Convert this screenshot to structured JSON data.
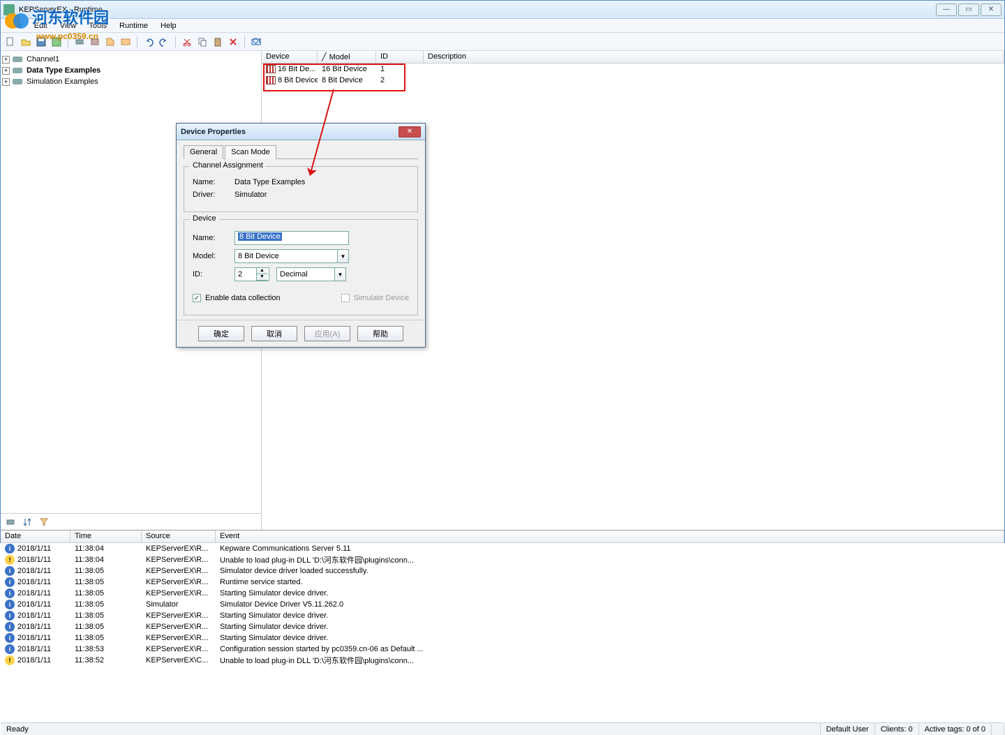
{
  "window": {
    "title": "KEPServerEX - Runtime"
  },
  "watermark": {
    "text": "河东软件园",
    "url": "www.pc0359.cn"
  },
  "menu": {
    "file": "File",
    "edit": "Edit",
    "view": "View",
    "tools": "Tools",
    "runtime": "Runtime",
    "help": "Help"
  },
  "tree": {
    "items": [
      {
        "label": "Channel1",
        "bold": false
      },
      {
        "label": "Data Type Examples",
        "bold": true
      },
      {
        "label": "Simulation Examples",
        "bold": false
      }
    ]
  },
  "grid": {
    "cols": {
      "device": "Device",
      "model": "Model",
      "id": "ID",
      "desc": "Description"
    },
    "rows": [
      {
        "device": "16 Bit De...",
        "model": "16 Bit Device",
        "id": "1"
      },
      {
        "device": "8 Bit Device",
        "model": "8 Bit Device",
        "id": "2"
      }
    ]
  },
  "dialog": {
    "title": "Device Properties",
    "tabs": {
      "general": "General",
      "scan": "Scan Mode"
    },
    "ch_group": "Channel Assignment",
    "ch_name_lbl": "Name:",
    "ch_name_val": "Data Type Examples",
    "ch_drv_lbl": "Driver:",
    "ch_drv_val": "Simulator",
    "dev_group": "Device",
    "dev_name_lbl": "Name:",
    "dev_name_val": "8 Bit Device",
    "dev_model_lbl": "Model:",
    "dev_model_val": "8 Bit Device",
    "dev_id_lbl": "ID:",
    "dev_id_val": "2",
    "dev_id_fmt": "Decimal",
    "chk_enable": "Enable data collection",
    "chk_sim": "Simulate Device",
    "btn_ok": "确定",
    "btn_cancel": "取消",
    "btn_apply": "应用(A)",
    "btn_help": "帮助"
  },
  "log": {
    "cols": {
      "date": "Date",
      "time": "Time",
      "src": "Source",
      "evt": "Event"
    },
    "rows": [
      {
        "lvl": "i",
        "date": "2018/1/11",
        "time": "11:38:04",
        "src": "KEPServerEX\\R...",
        "evt": "Kepware Communications Server 5.11"
      },
      {
        "lvl": "w",
        "date": "2018/1/11",
        "time": "11:38:04",
        "src": "KEPServerEX\\R...",
        "evt": "Unable to load plug-in DLL 'D:\\河东软件园\\plugins\\conn..."
      },
      {
        "lvl": "i",
        "date": "2018/1/11",
        "time": "11:38:05",
        "src": "KEPServerEX\\R...",
        "evt": "Simulator device driver loaded successfully."
      },
      {
        "lvl": "i",
        "date": "2018/1/11",
        "time": "11:38:05",
        "src": "KEPServerEX\\R...",
        "evt": "Runtime service started."
      },
      {
        "lvl": "i",
        "date": "2018/1/11",
        "time": "11:38:05",
        "src": "KEPServerEX\\R...",
        "evt": "Starting Simulator device driver."
      },
      {
        "lvl": "i",
        "date": "2018/1/11",
        "time": "11:38:05",
        "src": "Simulator",
        "evt": "Simulator Device Driver V5.11.262.0"
      },
      {
        "lvl": "i",
        "date": "2018/1/11",
        "time": "11:38:05",
        "src": "KEPServerEX\\R...",
        "evt": "Starting Simulator device driver."
      },
      {
        "lvl": "i",
        "date": "2018/1/11",
        "time": "11:38:05",
        "src": "KEPServerEX\\R...",
        "evt": "Starting Simulator device driver."
      },
      {
        "lvl": "i",
        "date": "2018/1/11",
        "time": "11:38:05",
        "src": "KEPServerEX\\R...",
        "evt": "Starting Simulator device driver."
      },
      {
        "lvl": "i",
        "date": "2018/1/11",
        "time": "11:38:53",
        "src": "KEPServerEX\\R...",
        "evt": "Configuration session started by pc0359.cn-06 as Default ..."
      },
      {
        "lvl": "w",
        "date": "2018/1/11",
        "time": "11:38:52",
        "src": "KEPServerEX\\C...",
        "evt": "Unable to load plug-in DLL 'D:\\河东软件园\\plugins\\conn..."
      }
    ]
  },
  "status": {
    "ready": "Ready",
    "user": "Default User",
    "clients": "Clients: 0",
    "tags": "Active tags: 0 of 0"
  }
}
